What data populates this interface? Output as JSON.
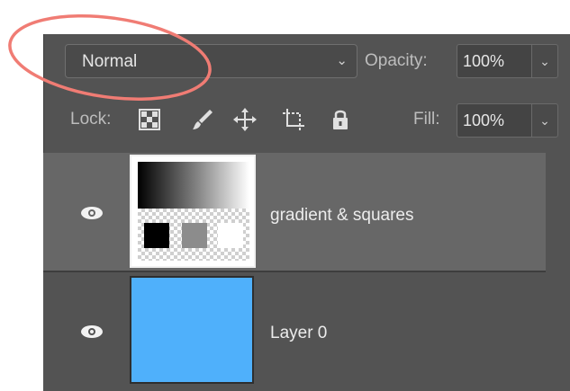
{
  "blend_mode": {
    "value": "Normal"
  },
  "opacity": {
    "label": "Opacity:",
    "value": "100%"
  },
  "lock": {
    "label": "Lock:",
    "icons": [
      "lock-transparent-pixels-icon",
      "lock-image-pixels-icon",
      "lock-position-icon",
      "lock-artboards-icon",
      "lock-all-icon"
    ]
  },
  "fill": {
    "label": "Fill:",
    "value": "100%"
  },
  "layers": [
    {
      "name": "gradient & squares",
      "visible": true,
      "selected": true
    },
    {
      "name": "Layer 0",
      "visible": true,
      "selected": false,
      "color": "#4fb0fb"
    }
  ],
  "annotation": {
    "color": "#f07c74"
  }
}
